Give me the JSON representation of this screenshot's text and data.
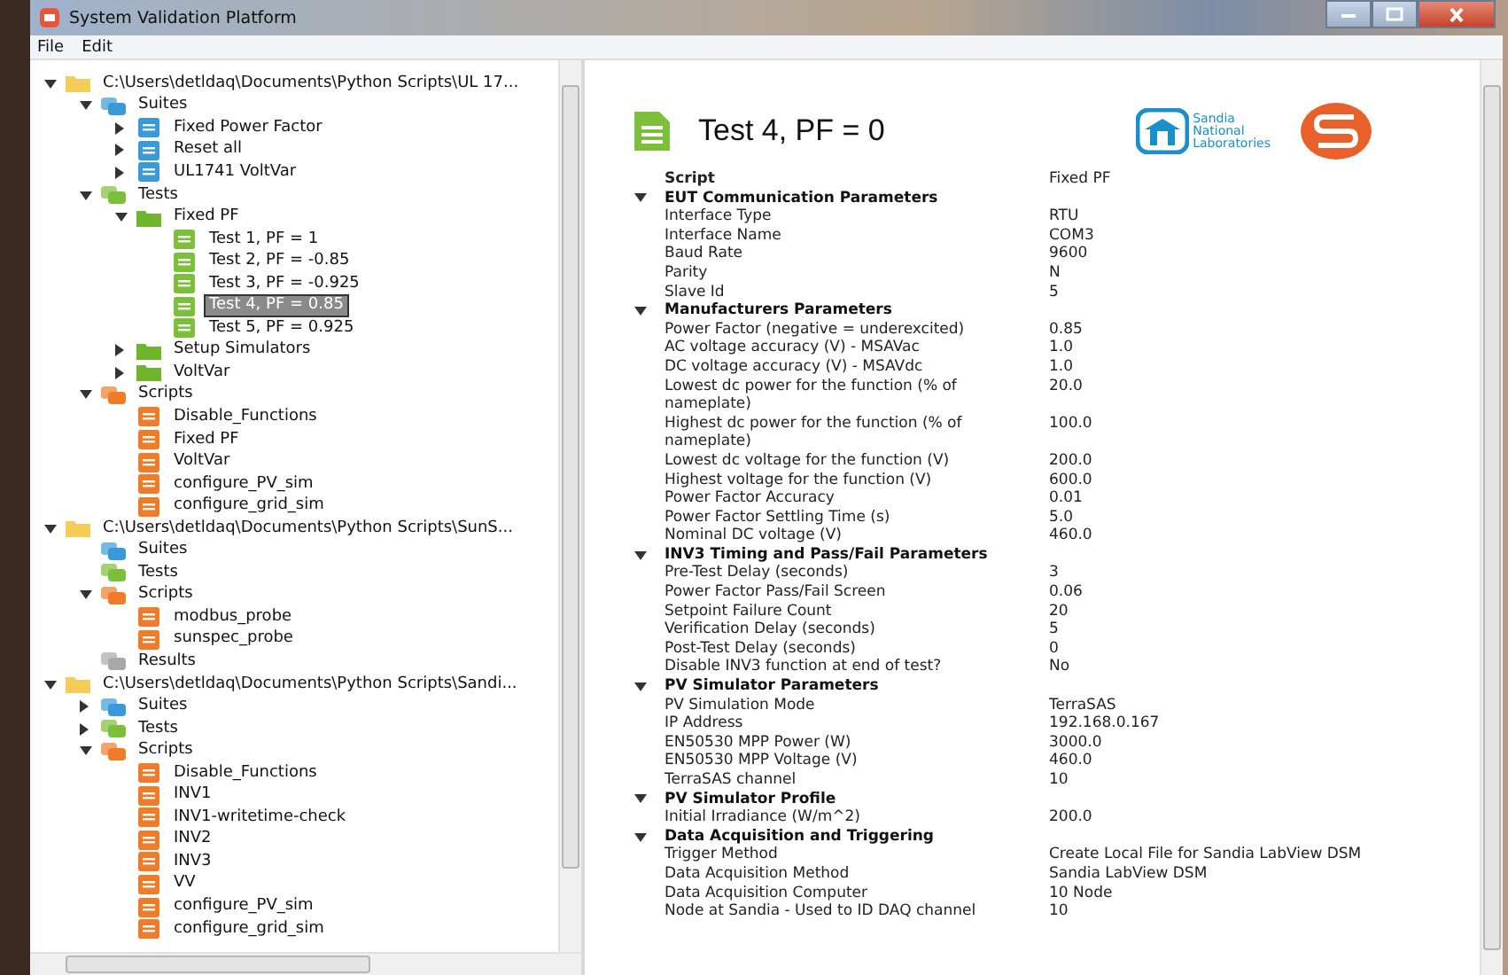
{
  "window": {
    "title": "System Validation Platform"
  },
  "menu": [
    "File",
    "Edit"
  ],
  "tree": [
    {
      "label": "C:\\Users\\detldaq\\Documents\\Python Scripts\\UL 17...",
      "kind": "folder",
      "expanded": true,
      "selected": false,
      "children": [
        {
          "label": "Suites",
          "kind": "suites",
          "expanded": true,
          "selected": false,
          "children": [
            {
              "label": "Fixed Power Factor",
              "kind": "suite",
              "expanded": false,
              "selected": false
            },
            {
              "label": "Reset all",
              "kind": "suite",
              "expanded": false,
              "selected": false
            },
            {
              "label": "UL1741 VoltVar",
              "kind": "suite",
              "expanded": false,
              "selected": false
            }
          ]
        },
        {
          "label": "Tests",
          "kind": "tests",
          "expanded": true,
          "selected": false,
          "children": [
            {
              "label": "Fixed PF",
              "kind": "testgroup",
              "expanded": true,
              "selected": false,
              "children": [
                {
                  "label": "Test 1, PF = 1",
                  "kind": "test",
                  "selected": false
                },
                {
                  "label": "Test 2, PF = -0.85",
                  "kind": "test",
                  "selected": false
                },
                {
                  "label": "Test 3, PF = -0.925",
                  "kind": "test",
                  "selected": false
                },
                {
                  "label": "Test 4, PF = 0.85",
                  "kind": "test",
                  "selected": true
                },
                {
                  "label": "Test 5, PF = 0.925",
                  "kind": "test",
                  "selected": false
                }
              ]
            },
            {
              "label": "Setup Simulators",
              "kind": "testgroup",
              "expanded": false,
              "selected": false
            },
            {
              "label": "VoltVar",
              "kind": "testgroup",
              "expanded": false,
              "selected": false
            }
          ]
        },
        {
          "label": "Scripts",
          "kind": "scripts",
          "expanded": true,
          "selected": false,
          "children": [
            {
              "label": "Disable_Functions",
              "kind": "script",
              "selected": false
            },
            {
              "label": "Fixed PF",
              "kind": "script",
              "selected": false
            },
            {
              "label": "VoltVar",
              "kind": "script",
              "selected": false
            },
            {
              "label": "configure_PV_sim",
              "kind": "script",
              "selected": false
            },
            {
              "label": "configure_grid_sim",
              "kind": "script",
              "selected": false
            }
          ]
        }
      ]
    },
    {
      "label": "C:\\Users\\detldaq\\Documents\\Python Scripts\\SunS...",
      "kind": "folder",
      "expanded": true,
      "selected": false,
      "children": [
        {
          "label": "Suites",
          "kind": "suites",
          "selected": false
        },
        {
          "label": "Tests",
          "kind": "tests",
          "selected": false
        },
        {
          "label": "Scripts",
          "kind": "scripts",
          "expanded": true,
          "selected": false,
          "children": [
            {
              "label": "modbus_probe",
              "kind": "script",
              "selected": false
            },
            {
              "label": "sunspec_probe",
              "kind": "script",
              "selected": false
            }
          ]
        },
        {
          "label": "Results",
          "kind": "results",
          "selected": false
        }
      ]
    },
    {
      "label": "C:\\Users\\detldaq\\Documents\\Python Scripts\\Sandi...",
      "kind": "folder",
      "expanded": true,
      "selected": false,
      "children": [
        {
          "label": "Suites",
          "kind": "suites",
          "expanded": false,
          "selected": false
        },
        {
          "label": "Tests",
          "kind": "tests",
          "expanded": false,
          "selected": false
        },
        {
          "label": "Scripts",
          "kind": "scripts",
          "expanded": true,
          "selected": false,
          "children": [
            {
              "label": "Disable_Functions",
              "kind": "script",
              "selected": false
            },
            {
              "label": "INV1",
              "kind": "script",
              "selected": false
            },
            {
              "label": "INV1-writetime-check",
              "kind": "script",
              "selected": false
            },
            {
              "label": "INV2",
              "kind": "script",
              "selected": false
            },
            {
              "label": "INV3",
              "kind": "script",
              "selected": false
            },
            {
              "label": "VV",
              "kind": "script",
              "selected": false
            },
            {
              "label": "configure_PV_sim",
              "kind": "script",
              "selected": false
            },
            {
              "label": "configure_grid_sim",
              "kind": "script",
              "selected": false
            }
          ]
        }
      ]
    }
  ],
  "detail": {
    "title": "Test 4, PF = 0",
    "logo_text": [
      "Sandia",
      "National",
      "Laboratories"
    ],
    "script": {
      "label": "Script",
      "value": "Fixed PF"
    },
    "groups": [
      {
        "title": "EUT Communication Parameters",
        "expanded": true,
        "items": [
          {
            "label": "Interface Type",
            "value": "RTU"
          },
          {
            "label": "Interface Name",
            "value": "COM3"
          },
          {
            "label": "Baud Rate",
            "value": "9600"
          },
          {
            "label": "Parity",
            "value": "N"
          },
          {
            "label": "Slave Id",
            "value": "5"
          }
        ]
      },
      {
        "title": "Manufacturers Parameters",
        "expanded": true,
        "items": [
          {
            "label": "Power Factor (negative = underexcited)",
            "value": "0.85"
          },
          {
            "label": "AC voltage accuracy (V) - MSAVac",
            "value": "1.0"
          },
          {
            "label": "DC voltage accuracy (V) - MSAVdc",
            "value": "1.0"
          },
          {
            "label": "Lowest dc power for the function (% of nameplate)",
            "value": "20.0"
          },
          {
            "label": "Highest dc power for the function (% of nameplate)",
            "value": "100.0"
          },
          {
            "label": "Lowest dc voltage for the function (V)",
            "value": "200.0"
          },
          {
            "label": "Highest voltage for the function (V)",
            "value": "600.0"
          },
          {
            "label": "Power Factor Accuracy",
            "value": "0.01"
          },
          {
            "label": "Power Factor Settling Time (s)",
            "value": "5.0"
          },
          {
            "label": "Nominal DC voltage (V)",
            "value": "460.0"
          }
        ]
      },
      {
        "title": "INV3 Timing and Pass/Fail Parameters",
        "expanded": true,
        "items": [
          {
            "label": "Pre-Test Delay (seconds)",
            "value": "3"
          },
          {
            "label": "Power Factor Pass/Fail Screen",
            "value": "0.06"
          },
          {
            "label": "Setpoint Failure Count",
            "value": "20"
          },
          {
            "label": "Verification Delay (seconds)",
            "value": "5"
          },
          {
            "label": "Post-Test Delay (seconds)",
            "value": "0"
          },
          {
            "label": "Disable INV3 function at end of test?",
            "value": "No"
          }
        ]
      },
      {
        "title": "PV Simulator Parameters",
        "expanded": true,
        "items": [
          {
            "label": "PV Simulation Mode",
            "value": "TerraSAS"
          },
          {
            "label": "IP Address",
            "value": "192.168.0.167"
          },
          {
            "label": "EN50530 MPP Power (W)",
            "value": "3000.0"
          },
          {
            "label": "EN50530 MPP Voltage (V)",
            "value": "460.0"
          },
          {
            "label": "TerraSAS channel",
            "value": "10"
          }
        ]
      },
      {
        "title": "PV Simulator Profile",
        "expanded": true,
        "items": [
          {
            "label": "Initial Irradiance (W/m^2)",
            "value": "200.0"
          }
        ]
      },
      {
        "title": "Data Acquisition and Triggering",
        "expanded": true,
        "items": [
          {
            "label": "Trigger Method",
            "value": "Create Local File for Sandia LabView DSM"
          },
          {
            "label": "Data Acquisition Method",
            "value": "Sandia LabView DSM"
          },
          {
            "label": "Data Acquisition Computer",
            "value": "10 Node"
          },
          {
            "label": "Node at Sandia - Used to ID DAQ channel",
            "value": "10"
          }
        ]
      }
    ]
  }
}
